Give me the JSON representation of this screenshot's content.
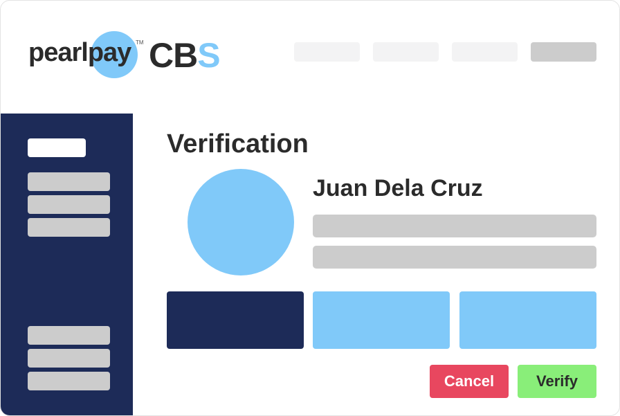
{
  "brand": {
    "name_part1": "pearl",
    "name_part2": "pay",
    "trademark": "TM",
    "product_part1": "CB",
    "product_part2": "S",
    "accent_color": "#80c9f9",
    "primary_color": "#1d2b58"
  },
  "header": {
    "nav_items": [
      {
        "state": "default"
      },
      {
        "state": "default"
      },
      {
        "state": "default"
      },
      {
        "state": "active"
      }
    ]
  },
  "sidebar": {
    "items": [
      {
        "state": "selected"
      },
      {
        "state": "default"
      },
      {
        "state": "default"
      },
      {
        "state": "default"
      },
      {
        "state": "default"
      },
      {
        "state": "default"
      },
      {
        "state": "default"
      }
    ]
  },
  "main": {
    "title": "Verification",
    "user_name": "Juan Dela Cruz"
  },
  "actions": {
    "cancel_label": "Cancel",
    "verify_label": "Verify",
    "cancel_color": "#e8475f",
    "verify_color": "#89ee79"
  }
}
